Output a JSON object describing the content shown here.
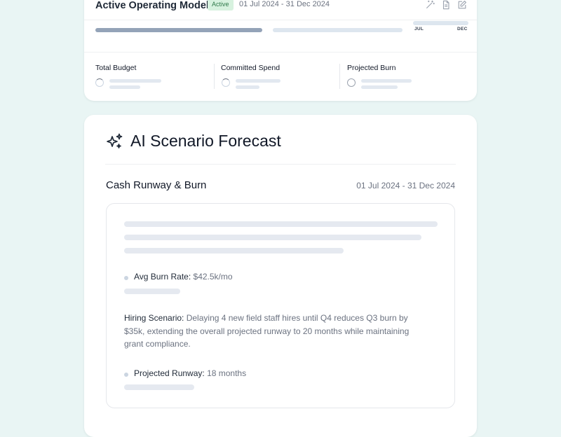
{
  "model": {
    "title": "Active Operating Model",
    "status": "Active",
    "dates": "01 Jul 2024 - 31 Dec 2024",
    "icons": [
      "magic-wand-icon",
      "document-icon",
      "edit-icon"
    ],
    "timeline": {
      "progress": 0.46,
      "months": [
        "JUL",
        "DEC"
      ]
    },
    "metrics": [
      {
        "label": "Total Budget"
      },
      {
        "label": "Committed Spend"
      },
      {
        "label": "Projected Burn"
      }
    ]
  },
  "forecast": {
    "title": "AI Scenario Forecast",
    "section_title": "Cash Runway & Burn",
    "section_dates": "01 Jul 2024 - 31 Dec 2024",
    "avg_burn_label": "Avg Burn Rate:",
    "avg_burn_value": "$42.5k/mo",
    "hiring_label": "Hiring Scenario:",
    "hiring_text": "Delaying 4 new field staff hires until Q4 reduces Q3 burn by $35k, extending the overall projected runway to 20 months while maintaining grant compliance.",
    "runway_label": "Projected Runway:",
    "runway_value": "18 months"
  },
  "colors": {
    "background": "#e9f5f4",
    "card": "#ffffff",
    "active_badge_bg": "#d7f2df",
    "active_badge_text": "#2f7a4a",
    "progress_fill": "#94a3b8",
    "skeleton": "#e5e9f0"
  }
}
